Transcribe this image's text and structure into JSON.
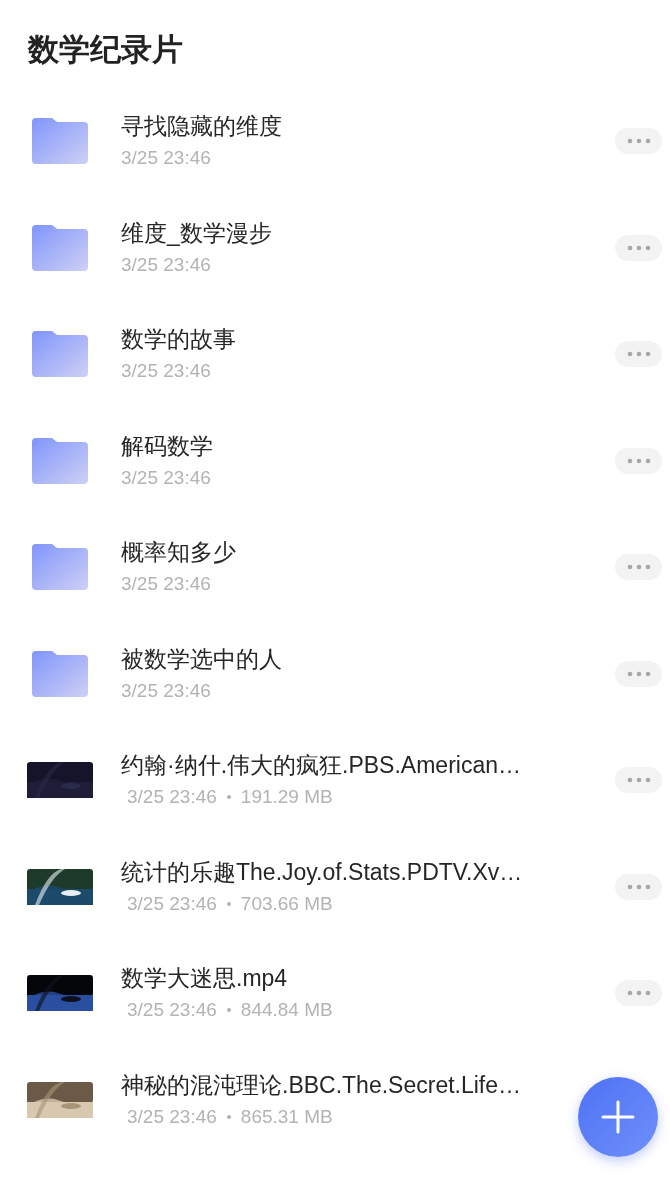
{
  "title": "数学纪录片",
  "items": [
    {
      "kind": "folder",
      "name": "寻找隐藏的维度",
      "date": "3/25 23:46"
    },
    {
      "kind": "folder",
      "name": "维度_数学漫步",
      "date": "3/25 23:46"
    },
    {
      "kind": "folder",
      "name": "数学的故事",
      "date": "3/25 23:46"
    },
    {
      "kind": "folder",
      "name": "解码数学",
      "date": "3/25 23:46"
    },
    {
      "kind": "folder",
      "name": "概率知多少",
      "date": "3/25 23:46"
    },
    {
      "kind": "folder",
      "name": "被数学选中的人",
      "date": "3/25 23:46"
    },
    {
      "kind": "video",
      "name": "约翰·纳什.伟大的疯狂.PBS.American…",
      "date": "3/25 23:46",
      "size": "191.29 MB"
    },
    {
      "kind": "video",
      "name": "统计的乐趣The.Joy.of.Stats.PDTV.Xv…",
      "date": "3/25 23:46",
      "size": "703.66 MB"
    },
    {
      "kind": "video",
      "name": "数学大迷思.mp4",
      "date": "3/25 23:46",
      "size": "844.84 MB"
    },
    {
      "kind": "video",
      "name": "神秘的混沌理论.BBC.The.Secret.Life…",
      "date": "3/25 23:46",
      "size": "865.31 MB"
    }
  ]
}
